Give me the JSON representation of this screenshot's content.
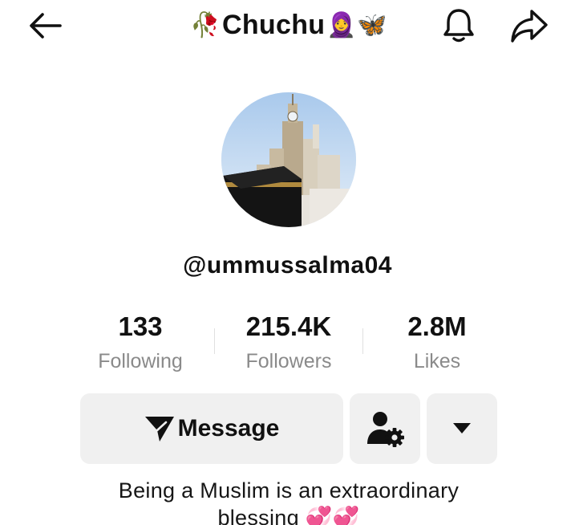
{
  "header": {
    "title_prefix_emoji": "🥀",
    "title_name": "Chuchu",
    "title_suffix_emoji": "🧕🦋"
  },
  "profile": {
    "username": "@ummussalma04"
  },
  "stats": {
    "following": {
      "value": "133",
      "label": "Following"
    },
    "followers": {
      "value": "215.4K",
      "label": "Followers"
    },
    "likes": {
      "value": "2.8M",
      "label": "Likes"
    }
  },
  "actions": {
    "message_label": "Message"
  },
  "bio": {
    "line1": "Being a Muslim is an extraordinary",
    "line2": "blessing 💞💞"
  },
  "icons": {
    "back": "arrow-left-icon",
    "notify": "bell-icon",
    "share": "share-arrow-icon",
    "message": "send-plane-icon",
    "friend_settings": "user-gear-icon",
    "more": "caret-down-icon"
  }
}
